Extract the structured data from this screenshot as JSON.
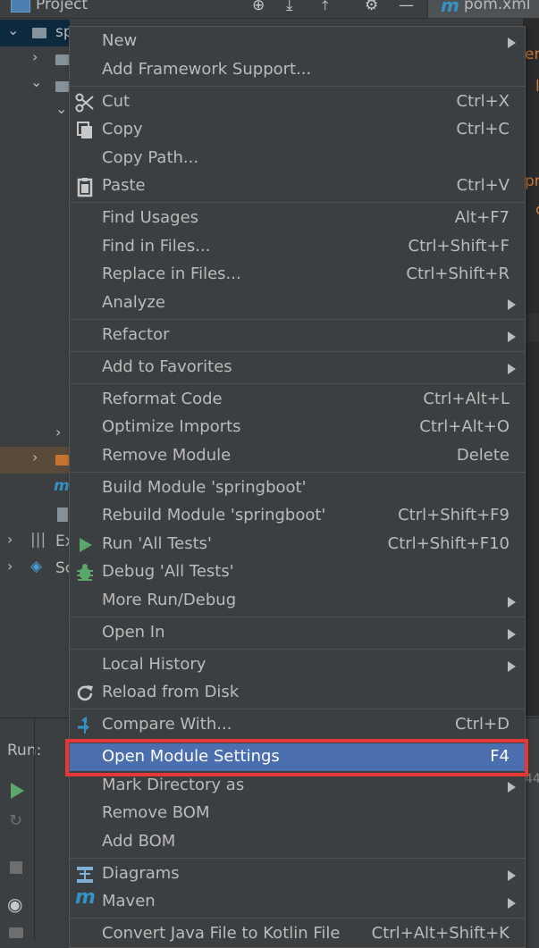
{
  "topbar": {
    "title": "Project",
    "tab": "pom.xml",
    "tab_icon": "m"
  },
  "tree": {
    "root": "sp",
    "items_visible": [
      "Ex",
      "Sc"
    ]
  },
  "editor_fragments": [
    "er",
    "l",
    "pr",
    "c"
  ],
  "runbar": {
    "label": "Run:",
    "number": "44"
  },
  "menu": {
    "items": [
      {
        "label": "New",
        "shortcut": "",
        "submenu": true
      },
      {
        "label": "Add Framework Support...",
        "shortcut": "",
        "submenu": false
      },
      {
        "label": "Cut",
        "shortcut": "Ctrl+X",
        "icon": "scissors-icon"
      },
      {
        "label": "Copy",
        "shortcut": "Ctrl+C",
        "icon": "copy-icon"
      },
      {
        "label": "Copy Path...",
        "shortcut": ""
      },
      {
        "label": "Paste",
        "shortcut": "Ctrl+V",
        "icon": "paste-icon"
      },
      {
        "label": "Find Usages",
        "shortcut": "Alt+F7"
      },
      {
        "label": "Find in Files...",
        "shortcut": "Ctrl+Shift+F"
      },
      {
        "label": "Replace in Files...",
        "shortcut": "Ctrl+Shift+R"
      },
      {
        "label": "Analyze",
        "shortcut": "",
        "submenu": true
      },
      {
        "label": "Refactor",
        "shortcut": "",
        "submenu": true
      },
      {
        "label": "Add to Favorites",
        "shortcut": "",
        "submenu": true
      },
      {
        "label": "Reformat Code",
        "shortcut": "Ctrl+Alt+L"
      },
      {
        "label": "Optimize Imports",
        "shortcut": "Ctrl+Alt+O"
      },
      {
        "label": "Remove Module",
        "shortcut": "Delete"
      },
      {
        "label": "Build Module 'springboot'",
        "shortcut": ""
      },
      {
        "label": "Rebuild Module 'springboot'",
        "shortcut": "Ctrl+Shift+F9"
      },
      {
        "label": "Run 'All Tests'",
        "shortcut": "Ctrl+Shift+F10",
        "icon": "run-icon"
      },
      {
        "label": "Debug 'All Tests'",
        "shortcut": "",
        "icon": "debug-icon"
      },
      {
        "label": "More Run/Debug",
        "shortcut": "",
        "submenu": true
      },
      {
        "label": "Open In",
        "shortcut": "",
        "submenu": true
      },
      {
        "label": "Local History",
        "shortcut": "",
        "submenu": true
      },
      {
        "label": "Reload from Disk",
        "shortcut": "",
        "icon": "reload-icon"
      },
      {
        "label": "Compare With...",
        "shortcut": "Ctrl+D",
        "icon": "compare-icon"
      },
      {
        "label": "Open Module Settings",
        "shortcut": "F4",
        "active": true
      },
      {
        "label": "Mark Directory as",
        "shortcut": "",
        "submenu": true
      },
      {
        "label": "Remove BOM",
        "shortcut": ""
      },
      {
        "label": "Add BOM",
        "shortcut": ""
      },
      {
        "label": "Diagrams",
        "shortcut": "",
        "submenu": true,
        "icon": "diagrams-icon"
      },
      {
        "label": "Maven",
        "shortcut": "",
        "submenu": true,
        "icon": "maven-icon"
      },
      {
        "label": "Convert Java File to Kotlin File",
        "shortcut": "Ctrl+Alt+Shift+K"
      }
    ]
  },
  "colors": {
    "menu_bg": "#3c3f41",
    "active_bg": "#4b6eaf",
    "highlight_border": "#e53935"
  }
}
